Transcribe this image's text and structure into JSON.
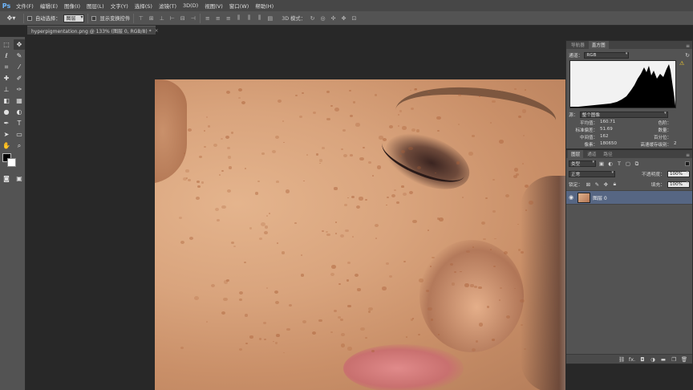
{
  "app": {
    "logo": "Ps"
  },
  "menu": [
    "文件(F)",
    "编辑(E)",
    "图像(I)",
    "图层(L)",
    "文字(Y)",
    "选择(S)",
    "滤镜(T)",
    "3D(D)",
    "视图(V)",
    "窗口(W)",
    "帮助(H)"
  ],
  "options": {
    "auto_select_label": "自动选择：",
    "auto_select_value": "图层",
    "show_transform_label": "显示变换控件",
    "mode_3d_label": "3D 模式："
  },
  "document_tab": {
    "title": "hyperpigmentation.png @ 133% (图层 0, RGB/8) *",
    "close": "×"
  },
  "histogram_panel": {
    "tabs": [
      "导航器",
      "直方图"
    ],
    "channel_label": "通道：",
    "channel_value": "RGB",
    "source_label": "源：",
    "source_value": "整个图像",
    "stats_left": [
      {
        "label": "平均值：",
        "value": "160.71"
      },
      {
        "label": "标准偏差：",
        "value": "51.69"
      },
      {
        "label": "中间值：",
        "value": "162"
      },
      {
        "label": "像素：",
        "value": "180650"
      }
    ],
    "stats_right": [
      {
        "label": "色阶：",
        "value": ""
      },
      {
        "label": "数量：",
        "value": ""
      },
      {
        "label": "百分位：",
        "value": ""
      },
      {
        "label": "高速缓存级别：",
        "value": "2"
      }
    ]
  },
  "layers_panel": {
    "tabs": [
      "图层",
      "通道",
      "路径"
    ],
    "filter_kind": "类型",
    "blend_mode": "正常",
    "opacity_label": "不透明度：",
    "opacity_value": "100%",
    "lock_label": "锁定：",
    "fill_label": "填充：",
    "fill_value": "100%",
    "layers": [
      {
        "name": "图层 0",
        "visible": true
      }
    ],
    "footer_icons": [
      "link-icon",
      "fx-icon",
      "mask-icon",
      "adjustment-icon",
      "group-icon",
      "new-layer-icon",
      "trash-icon"
    ],
    "footer_fx": "fx."
  },
  "colors": {
    "foreground": "#000000",
    "background": "#ffffff",
    "selected_layer": "#566683"
  }
}
